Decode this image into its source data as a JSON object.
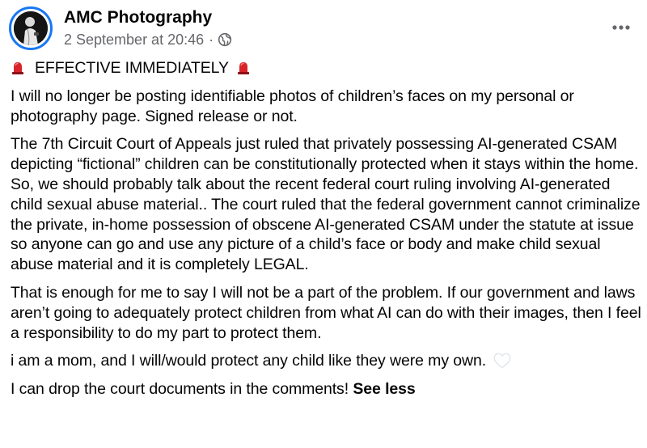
{
  "post": {
    "page_name": "AMC Photography",
    "timestamp": "2 September at 20:46",
    "separator": "·",
    "audience_icon": "globe-icon",
    "menu_icon": "more-options-icon",
    "headline_icon": "siren-light-icon",
    "headline": "EFFECTIVE IMMEDIATELY",
    "paragraphs": [
      "I will no longer be posting identifiable photos of children’s faces on my personal or photography page. Signed release or not.",
      "The 7th Circuit Court of Appeals just ruled that privately possessing AI-generated CSAM depicting “fictional” children can be constitutionally protected when it stays within the home. So, we should probably talk about the recent federal court ruling involving AI-generated child sexual abuse material.. The court ruled that the federal government cannot criminalize the private, in-home possession of obscene AI-generated CSAM under the statute at issue\nso anyone can go and use any picture of a child’s face or body and make child sexual abuse material and it is completely LEGAL.",
      "That is enough for me to say I will not be a part of the problem. If our government and laws aren’t going to adequately protect children from what AI can do with their images, then I feel a responsibility to do my part to protect them.",
      "i am a mom, and I will/would protect any child like they were my own."
    ],
    "heart_icon": "white-heart-icon",
    "closing": "I can drop the court documents in the comments!",
    "see_less": "See less",
    "colors": {
      "avatar_ring": "#1877f2",
      "secondary_text": "#65676b",
      "siren_red": "#d8232a"
    }
  }
}
